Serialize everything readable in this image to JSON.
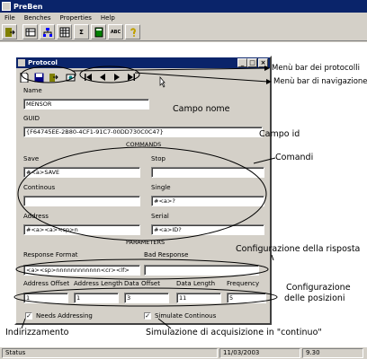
{
  "app": {
    "title": "PreBen",
    "menu": [
      "File",
      "Benches",
      "Properties",
      "Help"
    ],
    "toolbar_sigma": "Σ",
    "toolbar_abc": "ABC"
  },
  "dialog": {
    "title": "Protocol",
    "fields": {
      "name_label": "Name",
      "name_value": "MENSOR",
      "guid_label": "GUID",
      "guid_value": "{F64745EE-2B80-4CF1-91C7-00DD730C0C47}"
    },
    "commands": {
      "header": "COMMANDS",
      "save_label": "Save",
      "save_value": "#<a>SAVE",
      "stop_label": "Stop",
      "stop_value": "",
      "continous_label": "Continous",
      "continous_value": "",
      "single_label": "Single",
      "single_value": "#<a>?",
      "address_label": "Address",
      "address_value": "#<a><a><sp>n",
      "serial_label": "Serial",
      "serial_value": "#<a>ID?"
    },
    "parameters": {
      "header": "PARAMETERS",
      "response_format_label": "Response Format",
      "response_format_value": "<a><sp>nnnnnnnnnnnn<cr><lf>",
      "bad_response_label": "Bad Response",
      "bad_response_value": "",
      "address_offset_label": "Address Offset",
      "address_offset_value": "1",
      "address_length_label": "Address Length",
      "address_length_value": "1",
      "data_offset_label": "Data Offset",
      "data_offset_value": "3",
      "data_length_label": "Data Length",
      "data_length_value": "11",
      "frequency_label": "Frequency",
      "frequency_value": "5",
      "needs_addressing_label": "Needs Addressing",
      "needs_addressing_checked": true,
      "simulate_continous_label": "Simulate Continous",
      "simulate_continous_checked": true
    }
  },
  "status": {
    "text": "Status",
    "date": "11/03/2003",
    "time": "9.30"
  },
  "annotations": {
    "menu_bar_protocolli": "Menù bar dei protocolli",
    "menu_bar_navigazione": "Menù bar di navigazione",
    "campo_nome": "Campo nome",
    "campo_id": "Campo id",
    "comandi": "Comandi",
    "configurazione_risposta": "Configurazione della risposta",
    "configurazione_posizioni_1": "Configurazione",
    "configurazione_posizioni_2": "delle posizioni",
    "indirizzamento": "Indirizzamento",
    "simulazione": "Simulazione di acquisizione in \"continuo\""
  }
}
